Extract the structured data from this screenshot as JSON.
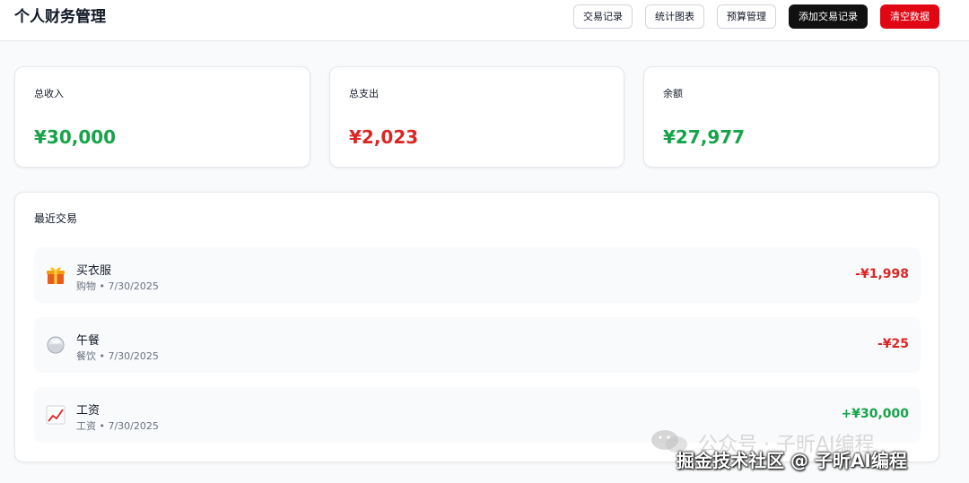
{
  "header": {
    "title": "个人财务管理",
    "nav": {
      "transactions": "交易记录",
      "charts": "统计图表",
      "budget": "预算管理",
      "add": "添加交易记录",
      "clear": "清空数据"
    }
  },
  "summary": {
    "income_label": "总收入",
    "income_value": "¥30,000",
    "expense_label": "总支出",
    "expense_value": "¥2,023",
    "balance_label": "余额",
    "balance_value": "¥27,977"
  },
  "recent": {
    "title": "最近交易",
    "items": [
      {
        "icon": "gift-icon",
        "title": "买衣服",
        "meta": "购物 • 7/30/2025",
        "amount": "-¥1,998"
      },
      {
        "icon": "bowl-icon",
        "title": "午餐",
        "meta": "餐饮 • 7/30/2025",
        "amount": "-¥25"
      },
      {
        "icon": "chart-up-icon",
        "title": "工资",
        "meta": "工资 • 7/30/2025",
        "amount": "+¥30,000"
      }
    ]
  },
  "watermark": {
    "line1": "公众号 · 子昕AI编程",
    "line2": "掘金技术社区 @ 子昕AI编程"
  },
  "colors": {
    "income": "#16a34a",
    "expense": "#dc2626",
    "primary_button": "#111111",
    "danger_button": "#e10613"
  }
}
